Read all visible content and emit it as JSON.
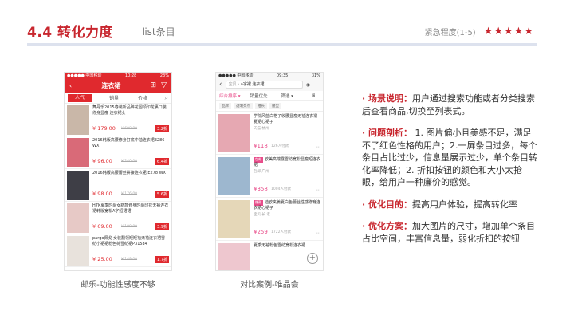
{
  "header": {
    "title": "4.4 转化力度",
    "subtitle": "list条目",
    "urgency_label": "紧急程度(1-5)",
    "stars": "★★★★★"
  },
  "left_phone": {
    "status_carrier": "●●●●● 中国移动",
    "status_time": "10:28",
    "status_battery": "23%",
    "nav_back": "‹",
    "nav_title": "连衣裙",
    "tabs": [
      "人气",
      "销量",
      "价格"
    ],
    "search_icon": "⌕",
    "items": [
      {
        "name": "舞丹乐2015春装新品碎花圆领印花裹口装 修身显瘦 连衣裙女",
        "price": "¥ 179.00",
        "old": "¥ 698.00",
        "badge": "3.2折",
        "color": "#c9b7a8"
      },
      {
        "name": "2016韩版高腰修身打底中袖连衣裙E286 WX",
        "price": "¥ 96.00",
        "old": "¥ 240.00",
        "badge": "6.4折",
        "color": "#d96a78"
      },
      {
        "name": "2016韩版高腰蕾丝拼接连衣裙 E278 WX",
        "price": "¥ 98.00",
        "old": "¥ 176.00",
        "badge": "5.6折",
        "color": "#3e3e46"
      },
      {
        "name": "H7K夏季时尚女新款修身时尚印花无袖连衣裙韩版宽松A字短裙裙",
        "price": "¥ 69.00",
        "old": "¥ 180.00",
        "badge": "3.9折",
        "color": "#e7c9c6"
      },
      {
        "name": "pargo佩戈 女装翻领短短袖无袖连衣裙雪纺小裙裙粉色荷雪纺裙P31584",
        "price": "¥ 25.00",
        "old": "¥ 149.00",
        "badge": "1.7折",
        "color": "#e8e2dc"
      }
    ],
    "caption": "邮乐-功能性感度不够"
  },
  "right_phone": {
    "status_carrier": "●●●●● 中国移动",
    "status_time": "09:35",
    "status_battery": "31%",
    "back": "‹",
    "search_scope": "宝贝 ›",
    "search_query": "a字裙 连衣裙",
    "camera_icon": "◉",
    "more_icon": "⋯",
    "sorts": [
      "综合排序 ▾",
      "销量优先",
      "筛选 ▾",
      "⊞"
    ],
    "chips": [
      "品牌",
      "透明亮点",
      "袖长",
      "腰型"
    ],
    "items": [
      {
        "name": "学院风蓝白格子收腰显瘦无袖连衣裙夏裙心裙子",
        "brand": "天猫  杭州",
        "tags": [],
        "price": "¥118",
        "sold": "126人付款",
        "color": "#e6a8b2"
      },
      {
        "name": "欧美高端露雪纺宽松显瘦短连衣裙",
        "brand": "包邮  广州",
        "tags": [
          "包邮"
        ],
        "price": "¥358",
        "sold": "1004人付款",
        "color": "#9db7cf"
      },
      {
        "name": "迪欧夹姜夏白色蕾丝性感修身连衣裙心裙子",
        "brand": "宝贝  长 老",
        "tags": [
          "爆款"
        ],
        "price": "¥259",
        "sold": "1722人付款",
        "color": "#e5d7b8"
      },
      {
        "name": "夏季无袖粉色雪纺宽松连衣裙",
        "brand": "",
        "tags": [],
        "price": "",
        "sold": "",
        "color": "#eec7cf"
      }
    ],
    "fab": "+",
    "caption": "对比案例-唯品会"
  },
  "notes": [
    {
      "label": "场景说明：",
      "text": "用户通过搜索功能或者分类搜索后查看商品,切换至列表式。"
    },
    {
      "label": "问题剖析：",
      "text": " 1. 图片偏小且美感不足，满足不了红色性格的用户；2.一屏条目过多，每个条目占比过少，信息量展示过少，单个条目转化率降低；2. 折扣按钮的颜色和大小太抢眼，给用户一种廉价的感觉。"
    },
    {
      "label": "优化目的：",
      "text": "提高用户体验，提高转化率"
    },
    {
      "label": "优化方案：",
      "text": "加大图片的尺寸，增加单个条目占比空间，丰富信息量，弱化折扣的按钮"
    }
  ],
  "colors": {
    "accent": "#c8262e",
    "vip_pink": "#e84d8a"
  }
}
